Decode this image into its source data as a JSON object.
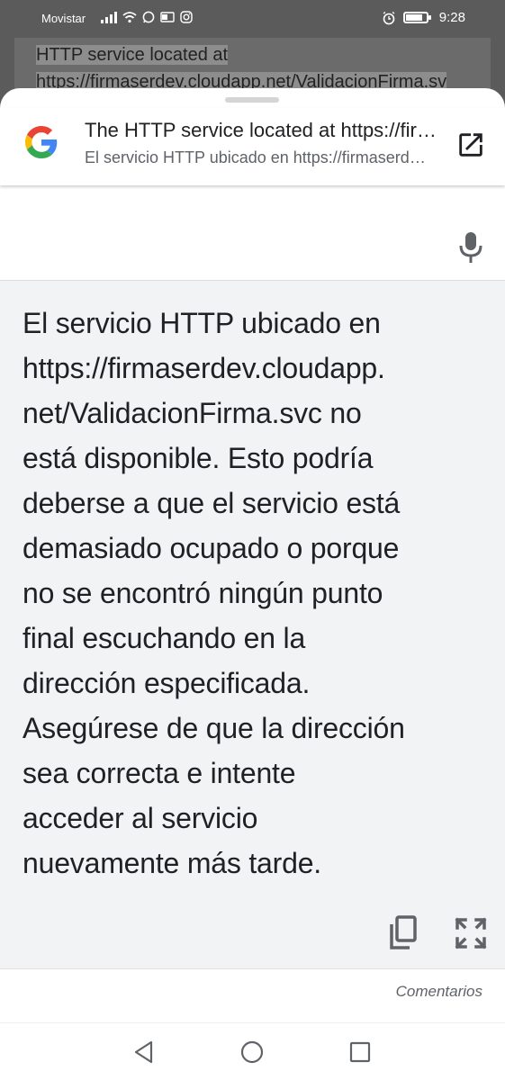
{
  "status_bar": {
    "carrier": "Movistar",
    "time": "9:28",
    "icons": [
      "signal-icon",
      "wifi-icon",
      "whatsapp-icon",
      "outlook-icon",
      "instagram-icon",
      "alarm-icon",
      "battery-icon"
    ]
  },
  "background_page": {
    "line1": "HTTP service located at",
    "line2": "https://firmaserdev.cloudapp.net/ValidacionFirma.sv"
  },
  "header": {
    "title": "The HTTP service located at https://firmaserdev.cloudapp.net/ValidacionFirma.svc",
    "subtitle": "El servicio HTTP ubicado en https://firmaserdev.cloudapp.net/ValidacionFirma.svc"
  },
  "result": {
    "lines": [
      "El servicio HTTP ubicado en",
      "https://firmaserdev.cloudapp.",
      "net/ValidacionFirma.svc no",
      "está disponible. Esto podría",
      "deberse a que el servicio está",
      "demasiado ocupado o porque",
      "no se encontró ningún punto",
      "final escuchando en la",
      "dirección especificada.",
      "Asegúrese de que la dirección",
      "sea correcta e intente",
      "acceder al servicio",
      "nuevamente más tarde."
    ]
  },
  "footer": {
    "feedback_label": "Comentarios"
  },
  "colors": {
    "google_blue": "#4285F4",
    "google_red": "#EA4335",
    "google_yellow": "#FBBC05",
    "google_green": "#34A853",
    "result_background": "#f1f3f4",
    "icon_gray": "#5f6368"
  }
}
